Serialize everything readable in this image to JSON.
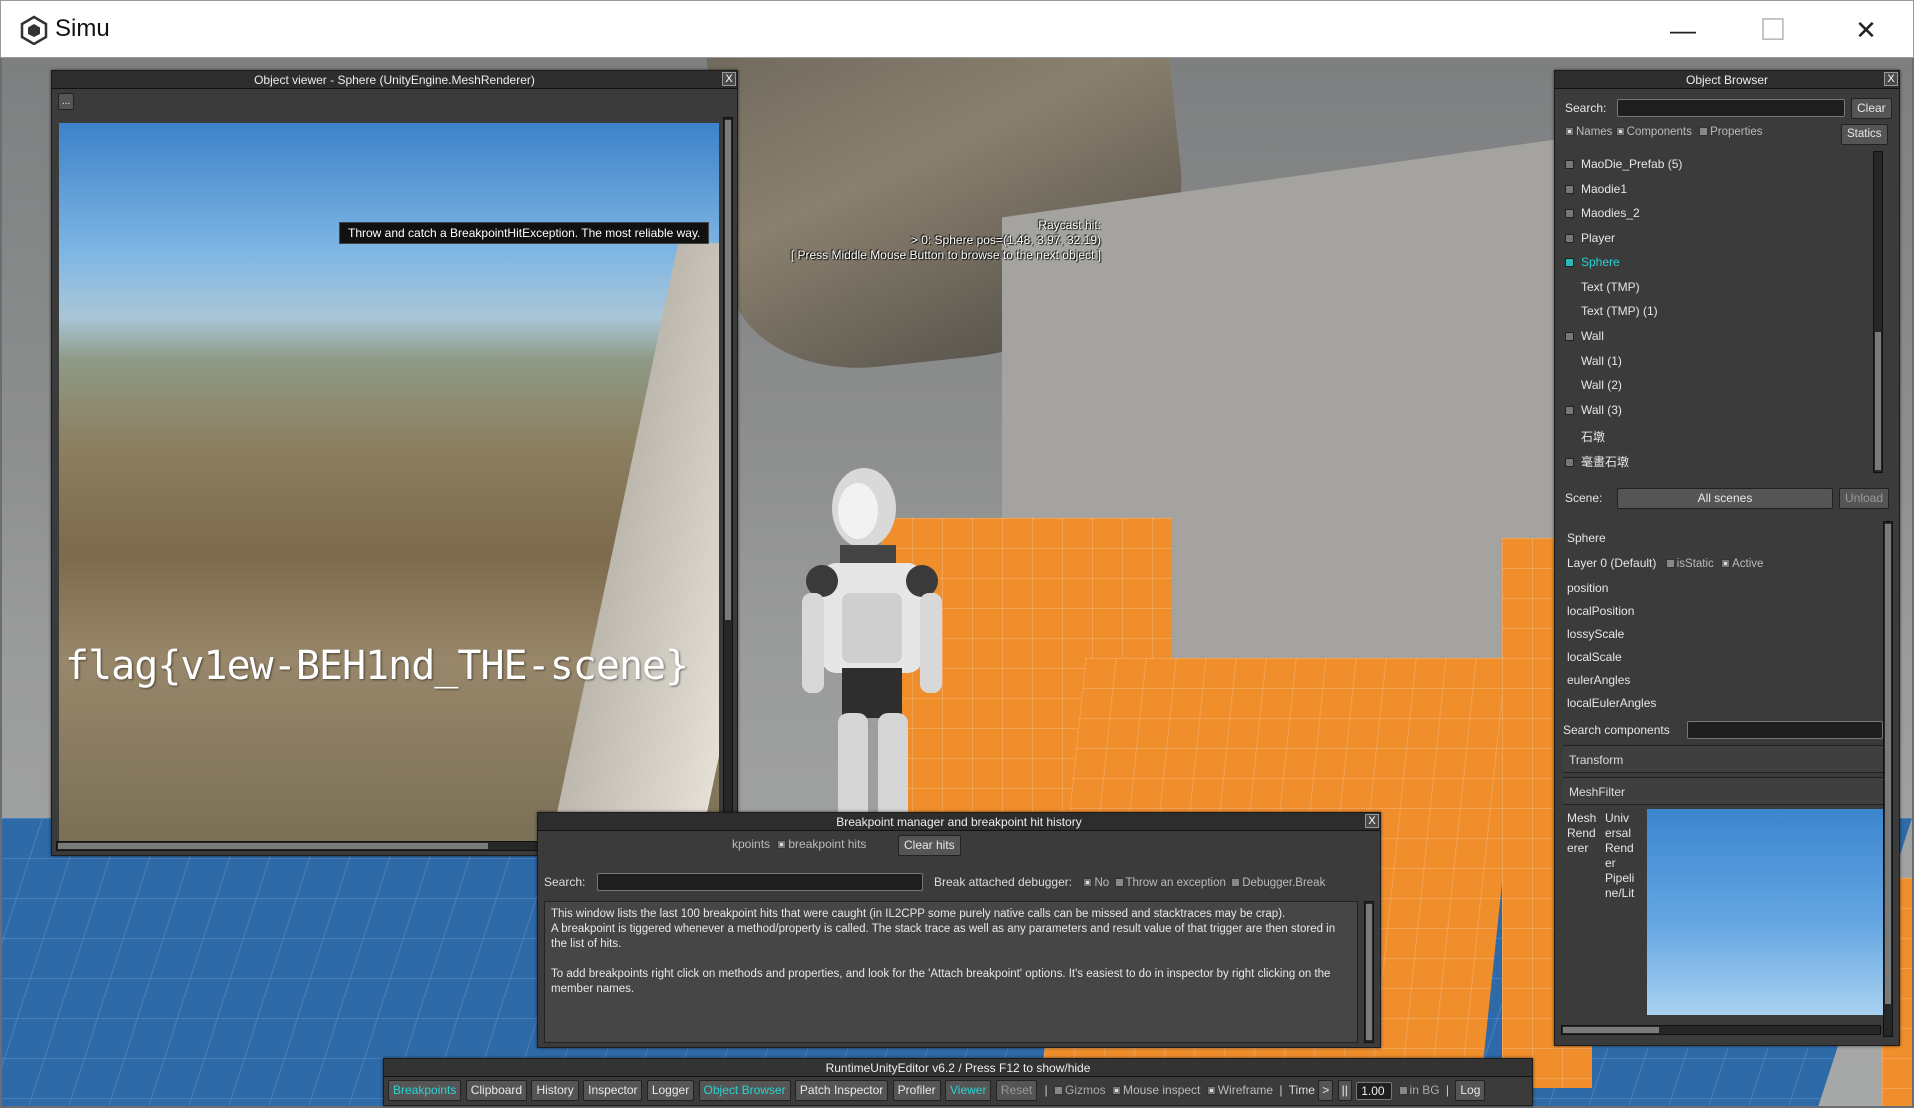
{
  "window": {
    "title": "Simu",
    "minimize_glyph": "—",
    "maximize_glyph": "☐",
    "close_glyph": "✕"
  },
  "object_viewer": {
    "title": "Object viewer - Sphere (UnityEngine.MeshRenderer)",
    "menu_button": "...",
    "close": "X",
    "render_text": "flag{v1ew-BEH1nd_THE-scene}"
  },
  "tooltip": "Throw and catch a BreakpointHitException. The most reliable way.",
  "raycast": {
    "line1": "Raycast hit:",
    "line2": "> 0: Sphere pos=(1.48, 3.97, 32.19)",
    "line3": "[ Press Middle Mouse Button to browse to the next object ]"
  },
  "object_browser": {
    "title": "Object Browser",
    "close": "X",
    "search_label": "Search:",
    "clear_button": "Clear",
    "filter_names": "Names",
    "filter_components": "Components",
    "filter_properties": "Properties",
    "statics_button": "Statics",
    "tree": [
      {
        "label": "MaoDie_Prefab (5)",
        "expander": true
      },
      {
        "label": "Maodie1",
        "expander": true
      },
      {
        "label": "Maodies_2",
        "expander": true
      },
      {
        "label": "Player",
        "expander": true
      },
      {
        "label": "Sphere",
        "expander": true,
        "selected": true
      },
      {
        "label": "Text (TMP)",
        "expander": false
      },
      {
        "label": "Text (TMP) (1)",
        "expander": false
      },
      {
        "label": "Wall",
        "expander": true
      },
      {
        "label": "Wall (1)",
        "expander": false
      },
      {
        "label": "Wall (2)",
        "expander": false
      },
      {
        "label": "Wall (3)",
        "expander": true
      },
      {
        "label": "石墩",
        "expander": false
      },
      {
        "label": "毫畫石墩",
        "expander": true
      }
    ],
    "scene_label": "Scene:",
    "scene_value": "All scenes",
    "unload_button": "Unload",
    "inspector": {
      "object_name": "Sphere",
      "layer": "Layer 0 (Default)",
      "is_static_label": "isStatic",
      "active_label": "Active",
      "properties": [
        "position",
        "localPosition",
        "lossyScale",
        "localScale",
        "eulerAngles",
        "localEulerAngles"
      ],
      "search_components_label": "Search components",
      "components": [
        "Transform",
        "MeshFilter"
      ],
      "mesh_renderer_col1": "Mesh Rend erer",
      "mesh_renderer_col2": "Univ ersal Rend er Pipeli ne/Lit"
    }
  },
  "breakpoint_manager": {
    "title": "Breakpoint manager and breakpoint hit history",
    "close": "X",
    "tab_partial": "kpoints",
    "tab_hits": "breakpoint hits",
    "clear_hits": "Clear hits",
    "search_label": "Search:",
    "break_label": "Break attached debugger:",
    "opt_no": "No",
    "opt_throw": "Throw an exception",
    "opt_debugger": "Debugger.Break",
    "text_p1": "This window lists the last 100 breakpoint hits that were caught (in IL2CPP some purely native calls can be missed and stacktraces may be crap).",
    "text_p2": "A breakpoint is tiggered whenever a method/property is called. The stack trace as well as any parameters and result value of that trigger are then stored in the list of hits.",
    "text_p3": "To add breakpoints right click on methods and properties, and look for the 'Attach breakpoint' options. It's easiest to do in inspector by right clicking on the member names."
  },
  "toolbar": {
    "title": "RuntimeUnityEditor v6.2 / Press F12 to show/hide",
    "buttons": [
      {
        "label": "Breakpoints",
        "active": true
      },
      {
        "label": "Clipboard",
        "active": false
      },
      {
        "label": "History",
        "active": false
      },
      {
        "label": "Inspector",
        "active": false
      },
      {
        "label": "Logger",
        "active": false
      },
      {
        "label": "Object Browser",
        "active": true
      },
      {
        "label": "Patch Inspector",
        "active": false
      },
      {
        "label": "Profiler",
        "active": false
      },
      {
        "label": "Viewer",
        "active": true
      }
    ],
    "reset": "Reset",
    "gizmos": "Gizmos",
    "mouse_inspect": "Mouse inspect",
    "wireframe": "Wireframe",
    "time_label": "Time",
    "play_glyph": ">",
    "pause_glyph": "||",
    "time_value": "1.00",
    "in_bg": "in BG",
    "log": "Log"
  }
}
